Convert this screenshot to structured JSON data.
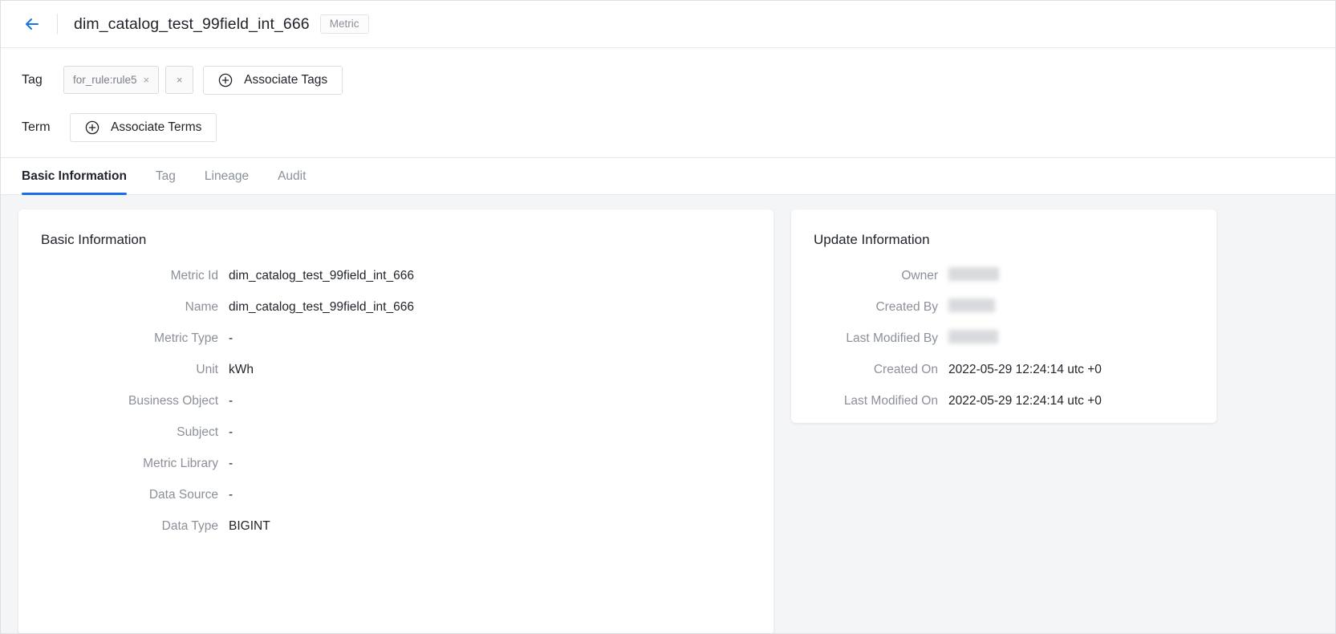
{
  "header": {
    "back_icon": "arrow-left-icon",
    "title": "dim_catalog_test_99field_int_666",
    "badge": "Metric"
  },
  "meta": {
    "tag_label": "Tag",
    "tag_chip": "for_rule:rule5",
    "tag_chip_remove": "×",
    "tag_clear": "×",
    "associate_tags": "Associate Tags",
    "term_label": "Term",
    "associate_terms": "Associate Terms"
  },
  "tabs": [
    {
      "label": "Basic Information",
      "active": true
    },
    {
      "label": "Tag",
      "active": false
    },
    {
      "label": "Lineage",
      "active": false
    },
    {
      "label": "Audit",
      "active": false
    }
  ],
  "basic_information": {
    "title": "Basic Information",
    "rows": [
      {
        "label": "Metric Id",
        "value": "dim_catalog_test_99field_int_666"
      },
      {
        "label": "Name",
        "value": "dim_catalog_test_99field_int_666"
      },
      {
        "label": "Metric Type",
        "value": "-"
      },
      {
        "label": "Unit",
        "value": "kWh"
      },
      {
        "label": "Business Object",
        "value": "-"
      },
      {
        "label": "Subject",
        "value": "-"
      },
      {
        "label": "Metric Library",
        "value": "-"
      },
      {
        "label": "Data Source",
        "value": "-"
      },
      {
        "label": "Data Type",
        "value": "BIGINT"
      }
    ]
  },
  "update_information": {
    "title": "Update Information",
    "rows": [
      {
        "label": "Owner",
        "value": "",
        "redacted": true,
        "redacted_width": 63
      },
      {
        "label": "Created By",
        "value": "",
        "redacted": true,
        "redacted_width": 58
      },
      {
        "label": "Last Modified By",
        "value": "",
        "redacted": true,
        "redacted_width": 62
      },
      {
        "label": "Created On",
        "value": "2022-05-29 12:24:14 utc +0",
        "redacted": false
      },
      {
        "label": "Last Modified On",
        "value": "2022-05-29 12:24:14 utc +0",
        "redacted": false
      }
    ]
  },
  "colors": {
    "accent": "#1a6fe8",
    "back_arrow": "#1a73e8",
    "page_bg": "#f4f5f7",
    "card_bg": "#ffffff",
    "text": "#1f2329",
    "muted": "#8b9099"
  }
}
